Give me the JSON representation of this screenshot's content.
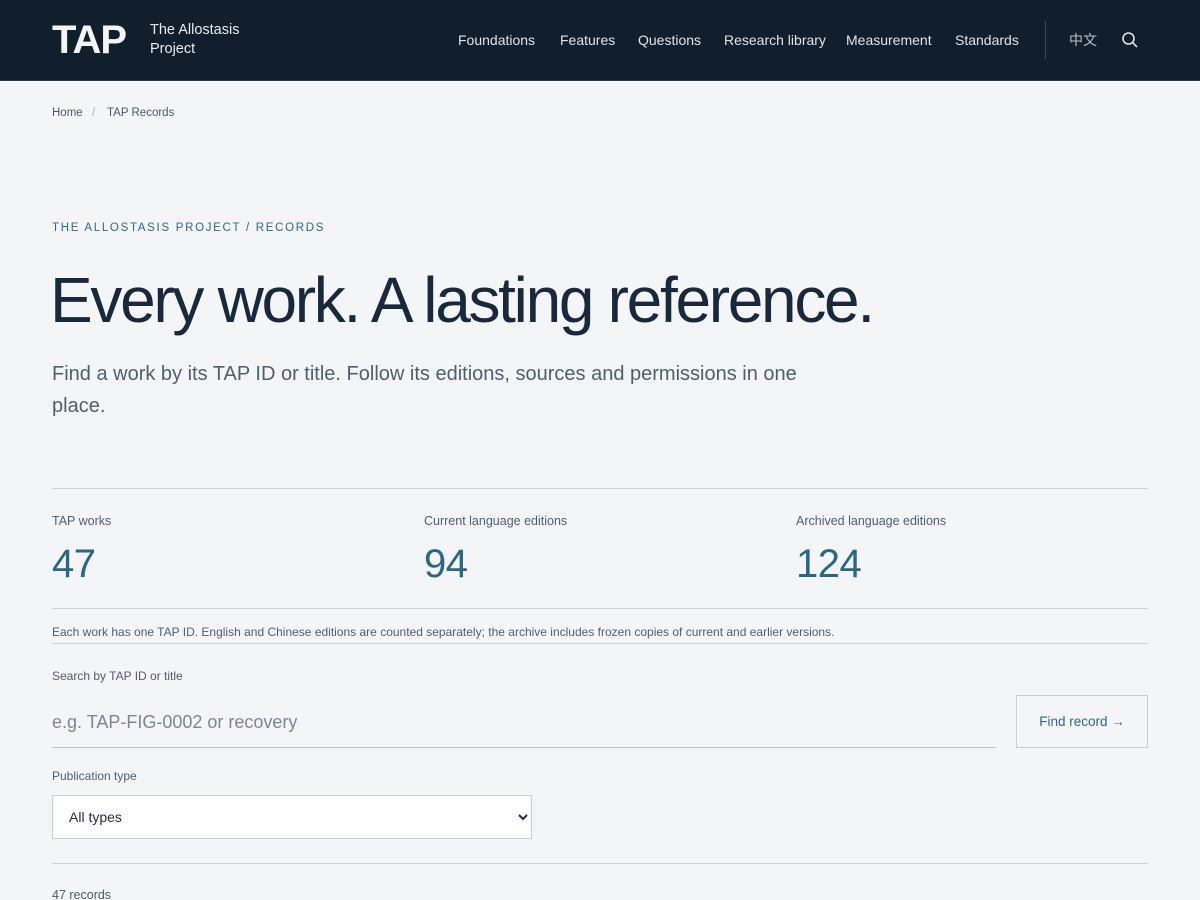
{
  "header": {
    "logo": "TAP",
    "site_name": "The Allostasis Project",
    "nav": [
      "Foundations",
      "Features",
      "Questions",
      "Research library",
      "Measurement",
      "Standards"
    ],
    "language_toggle": "中文",
    "search_icon": "search-icon"
  },
  "breadcrumb": {
    "home": "Home",
    "separator": "/",
    "current": "TAP Records"
  },
  "hero": {
    "eyebrow": "The Allostasis Project / Records",
    "title": "Every work. A lasting reference.",
    "intro": "Find a work by its TAP ID or title. Follow its editions, sources and permissions in one place."
  },
  "stats": [
    {
      "label": "TAP works",
      "value": "47"
    },
    {
      "label": "Current language editions",
      "value": "94"
    },
    {
      "label": "Archived language editions",
      "value": "124"
    }
  ],
  "note": "Each work has one TAP ID. English and Chinese editions are counted separately; the archive includes frozen copies of current and earlier versions.",
  "search": {
    "label": "Search by TAP ID or title",
    "placeholder": "e.g. TAP-FIG-0002 or recovery",
    "value": "",
    "button": "Find record →"
  },
  "filter": {
    "label": "Publication type",
    "selected": "All types"
  },
  "results": {
    "count_text": "47 records"
  },
  "colors": {
    "header_bg": "#111e2b",
    "page_bg": "#f4f5f7",
    "accent": "#2e6986",
    "heading": "#17293a"
  }
}
